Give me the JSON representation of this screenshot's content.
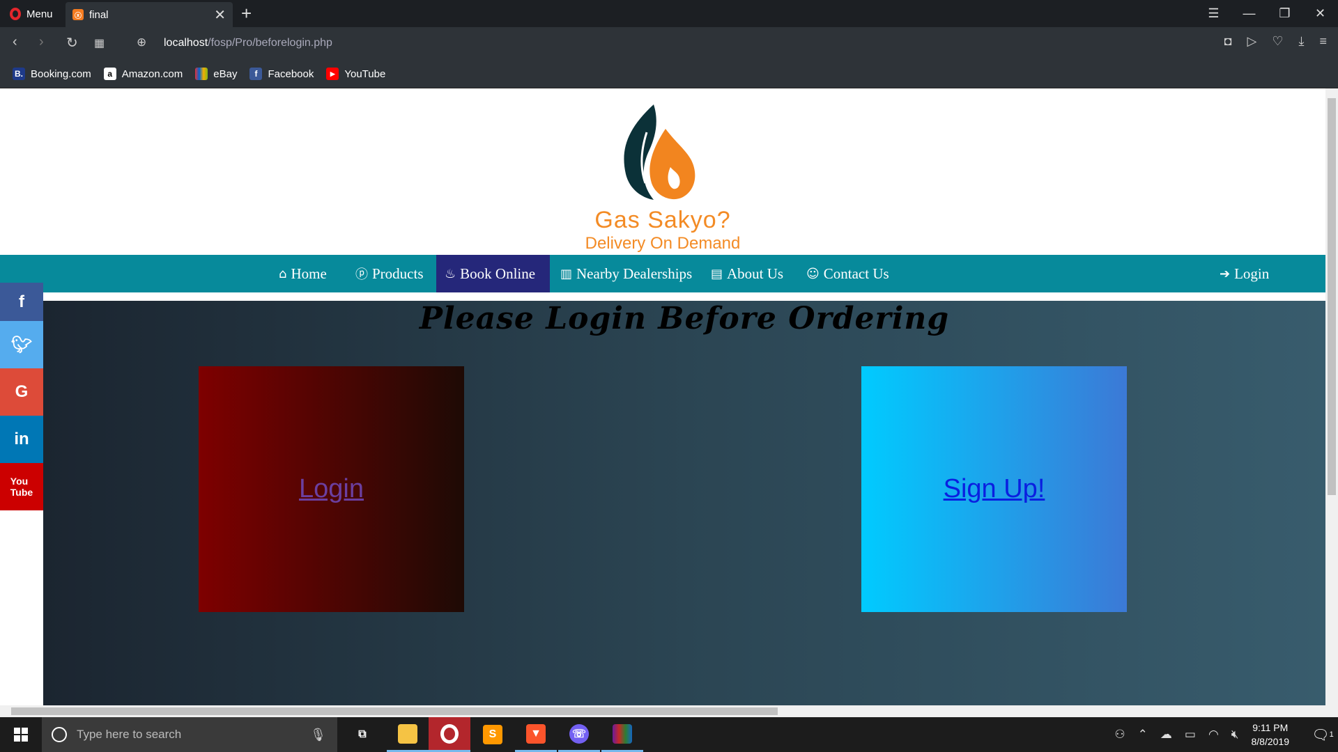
{
  "browser": {
    "menu_label": "Menu",
    "tab_title": "final",
    "url_host": "localhost",
    "url_path": "/fosp/Pro/beforelogin.php",
    "bookmarks": [
      {
        "label": "Booking.com",
        "icon": "booking-icon",
        "color": "#1e3a8a",
        "glyph": "B."
      },
      {
        "label": "Amazon.com",
        "icon": "amazon-icon",
        "color": "#fff",
        "glyph": "a"
      },
      {
        "label": "eBay",
        "icon": "ebay-icon",
        "color": "#e53238",
        "glyph": "e"
      },
      {
        "label": "Facebook",
        "icon": "facebook-icon",
        "color": "#3b5998",
        "glyph": "f"
      },
      {
        "label": "YouTube",
        "icon": "youtube-icon",
        "color": "#ff0000",
        "glyph": "▶"
      }
    ]
  },
  "site": {
    "brand_title": "Gas Sakyo?",
    "brand_tagline": "Delivery On Demand",
    "colors": {
      "nav": "#078a9b",
      "nav_active": "#25277a",
      "brand_orange": "#f38b25"
    },
    "nav": {
      "home": "Home",
      "products": "Products",
      "book_online": "Book Online",
      "nearby": "Nearby Dealerships",
      "about": "About Us",
      "contact": "Contact Us",
      "login": "Login"
    },
    "heading": "Please Login Before Ordering",
    "login_card": "Login",
    "signup_card": "Sign Up!",
    "social": [
      "facebook-icon",
      "twitter-icon",
      "google-icon",
      "linkedin-icon",
      "youtube-icon"
    ]
  },
  "taskbar": {
    "search_placeholder": "Type here to search",
    "time": "9:11 PM",
    "date": "8/8/2019",
    "notification_count": "1"
  }
}
